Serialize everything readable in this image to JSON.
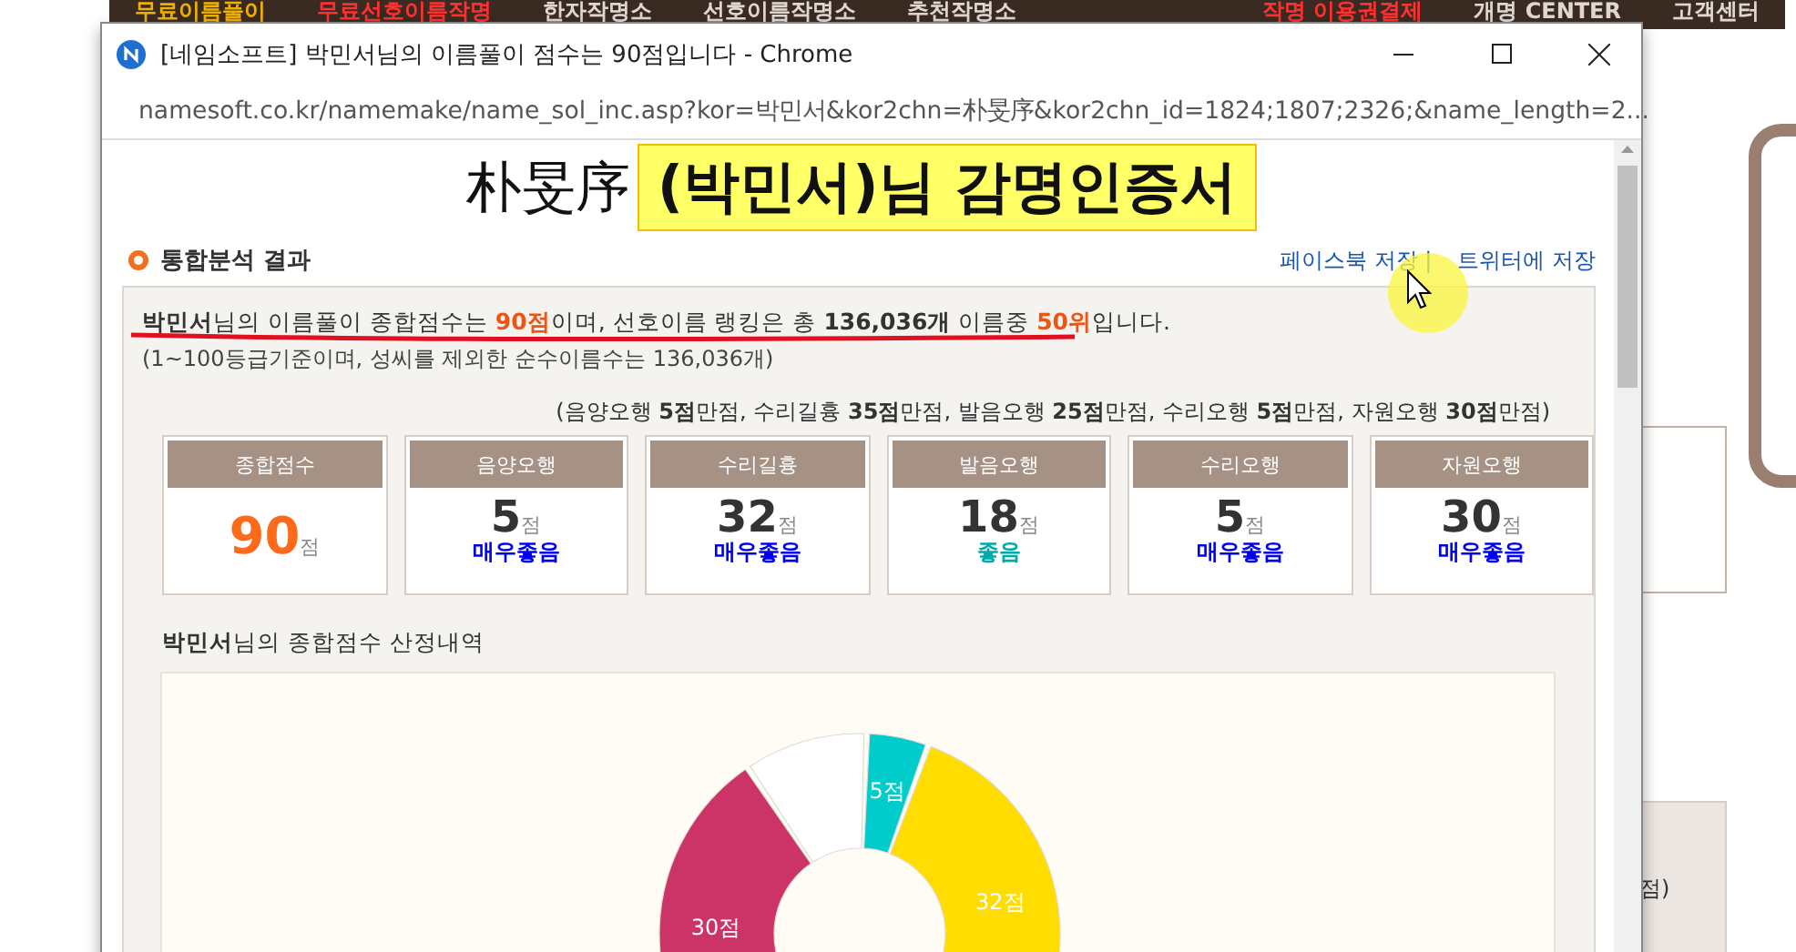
{
  "background_nav": [
    {
      "label": "무료이름풀이",
      "kind": "current"
    },
    {
      "label": "무료선호이름작명",
      "kind": "promo"
    },
    {
      "label": "한자작명소",
      "kind": "normal"
    },
    {
      "label": "선호이름작명소",
      "kind": "normal"
    },
    {
      "label": "추천작명소",
      "kind": "normal"
    },
    {
      "label": "작명 이용권결제",
      "kind": "promo"
    },
    {
      "label": "개명 CENTER",
      "kind": "normal"
    },
    {
      "label": "고객센터",
      "kind": "normal"
    }
  ],
  "background_fragment": "점)",
  "window": {
    "title": "[네임소프트] 박민서님의 이름풀이 점수는 90점입니다 - Chrome",
    "url": "namesoft.co.kr/namemake/name_sol_inc.asp?kor=박민서&kor2chn=朴旻序&kor2chn_id=1824;1807;2326;&name_length=2..."
  },
  "certificate": {
    "hanja": "朴旻序",
    "title": "(박민서)님 감명인증서"
  },
  "section": {
    "title": "통합분석 결과",
    "links": [
      "페이스북 저장 |",
      "트위터에 저장"
    ]
  },
  "summary": {
    "text": "**박민서**님의 이름풀이 종합점수는 **90점**이며, 선호이름 랭킹은 총 **136,036개** 이름중 **50위**입니다.",
    "note": "(1~100등급기준이며, 성씨를 제외한 순수이름수는 136,036개)",
    "max_note": "(음양오행 **5점**만점, 수리길흉 **35점**만점, 발음오행 **25점**만점, 수리오행 **5점**만점, 자원오행 **30점**만점)"
  },
  "scores": [
    {
      "kind": "total",
      "label": "종합점수",
      "value": "90",
      "unit": "점"
    },
    {
      "kind": "element",
      "label": "음양오행",
      "value": "5",
      "unit": "점",
      "grade": "매우좋음",
      "color": "#0000ee"
    },
    {
      "kind": "element",
      "label": "수리길흉",
      "value": "32",
      "unit": "점",
      "grade": "매우좋음",
      "color": "#0000ee"
    },
    {
      "kind": "element",
      "label": "발음오행",
      "value": "18",
      "unit": "점",
      "grade": "좋음",
      "color": "#00aaaa"
    },
    {
      "kind": "element",
      "label": "수리오행",
      "value": "5",
      "unit": "점",
      "grade": "매우좋음",
      "color": "#0000ee"
    },
    {
      "kind": "element",
      "label": "자원오행",
      "value": "30",
      "unit": "점",
      "grade": "매우좋음",
      "color": "#0000ee"
    }
  ],
  "breakdown": {
    "title": "**박민서**님의 종합점수 산정내역",
    "chart_data": {
      "type": "donut",
      "values": [
        5,
        32,
        null,
        null,
        30,
        10
      ],
      "colors": [
        "#00cccc",
        "#ffdd00",
        null,
        null,
        "#cc3366",
        "#ffffff"
      ],
      "value_labels": [
        "5점",
        "32점",
        null,
        null,
        "30점",
        null
      ]
    }
  }
}
